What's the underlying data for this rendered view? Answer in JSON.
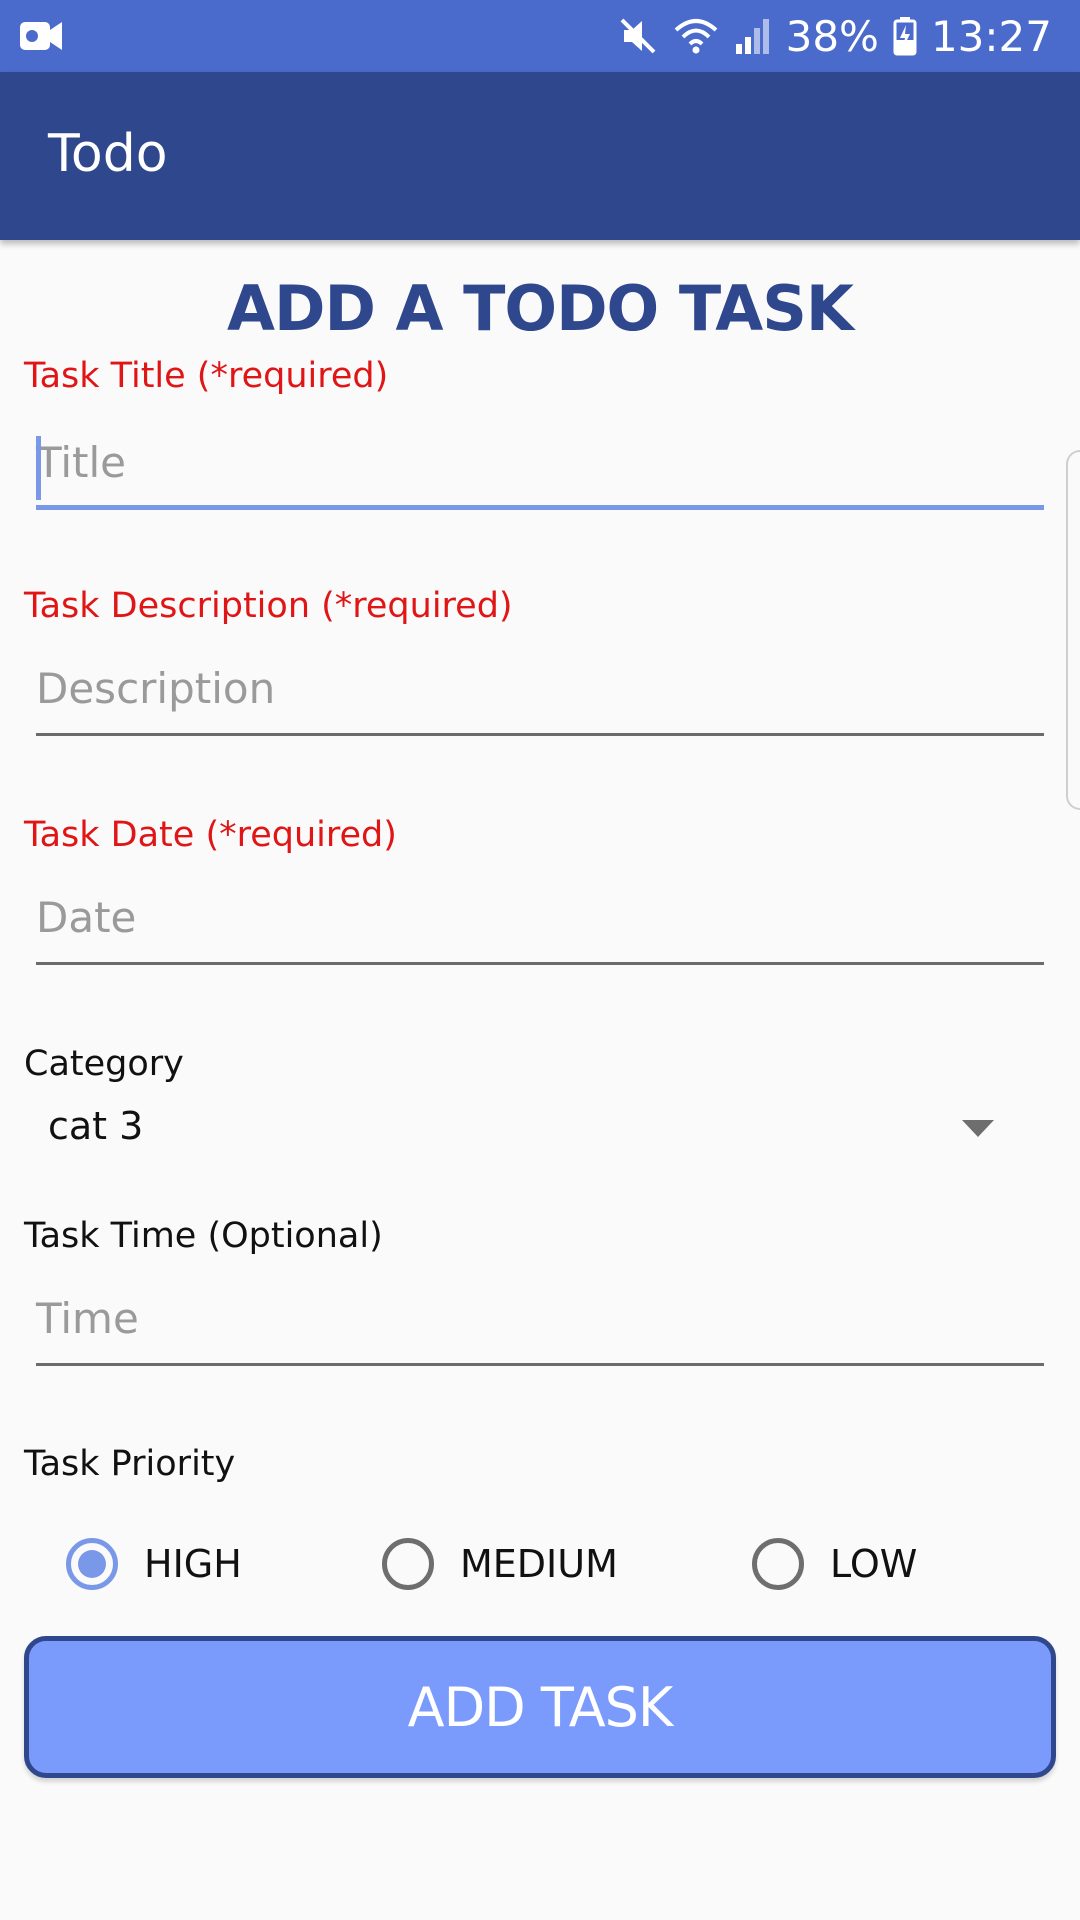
{
  "status_bar": {
    "battery": "38%",
    "time": "13:27"
  },
  "app_bar": {
    "title": "Todo"
  },
  "form": {
    "heading": "ADD A TODO TASK",
    "title_field": {
      "label": "Task Title (*required)",
      "placeholder": "Title"
    },
    "description_field": {
      "label": "Task Description (*required)",
      "placeholder": "Description"
    },
    "date_field": {
      "label": "Task Date (*required)",
      "placeholder": "Date"
    },
    "category": {
      "label": "Category",
      "selected": "cat 3"
    },
    "time_field": {
      "label": "Task Time (Optional)",
      "placeholder": "Time"
    },
    "priority": {
      "label": "Task Priority",
      "options": [
        "HIGH",
        "MEDIUM",
        "LOW"
      ],
      "selected": "HIGH"
    },
    "submit_label": "ADD TASK"
  },
  "colors": {
    "status_bar": "#4a6bcc",
    "app_bar": "#2f478c",
    "required_label": "#e01616",
    "accent": "#7a98e8",
    "button_fill": "#7a9bfb",
    "button_border": "#2f478c"
  },
  "icons": {
    "status_left": "video-camera-icon",
    "status_right": [
      "mute-icon",
      "wifi-icon",
      "signal-icon",
      "battery-charging-icon"
    ],
    "spinner": "dropdown-arrow-icon"
  }
}
